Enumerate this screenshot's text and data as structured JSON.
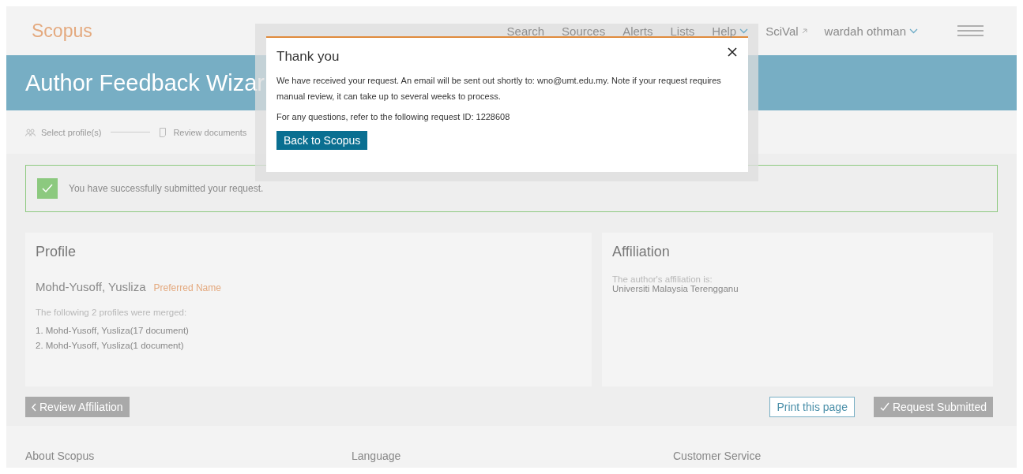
{
  "header": {
    "logo": "Scopus",
    "nav": [
      {
        "label": "Search",
        "kind": "plain"
      },
      {
        "label": "Sources",
        "kind": "plain"
      },
      {
        "label": "Alerts",
        "kind": "plain"
      },
      {
        "label": "Lists",
        "kind": "plain"
      },
      {
        "label": "Help",
        "kind": "dropdown"
      },
      {
        "label": "SciVal",
        "kind": "external"
      },
      {
        "label": "wardah othman",
        "kind": "dropdown"
      }
    ]
  },
  "banner": {
    "title": "Author Feedback Wizar"
  },
  "steps": [
    {
      "label": "Select profile(s)",
      "kind": "people"
    },
    {
      "label": "Review documents",
      "kind": "document"
    }
  ],
  "alert": {
    "text": "You have successfully submitted your request."
  },
  "profile": {
    "heading": "Profile",
    "name": "Mohd-Yusoff, Yusliza",
    "badge": "Preferred Name",
    "note": "The following 2 profiles were merged:",
    "merged": [
      "1. Mohd-Yusoff, Yusliza(17 document)",
      "2. Mohd-Yusoff, Yusliza(1 document)"
    ]
  },
  "affiliation": {
    "heading": "Affiliation",
    "label": "The author's affiliation is:",
    "value": "Universiti Malaysia Terengganu"
  },
  "actions": [
    {
      "label": "Review Affiliation",
      "kind": "back",
      "disabled": true
    },
    {
      "label": "Print this page",
      "kind": "outline",
      "disabled": false
    },
    {
      "label": "Request Submitted",
      "kind": "done",
      "disabled": true
    }
  ],
  "footer": {
    "columns": [
      "About Scopus",
      "Language",
      "Customer Service"
    ]
  },
  "modal": {
    "title": "Thank you",
    "paragraphs": [
      "We have received your request. An email will be sent out shortly to: wno@umt.edu.my. Note if your request requires manual review, it can take up to several weeks to process.",
      "For any questions, refer to the following request ID: 1228608"
    ],
    "button": "Back to Scopus"
  }
}
